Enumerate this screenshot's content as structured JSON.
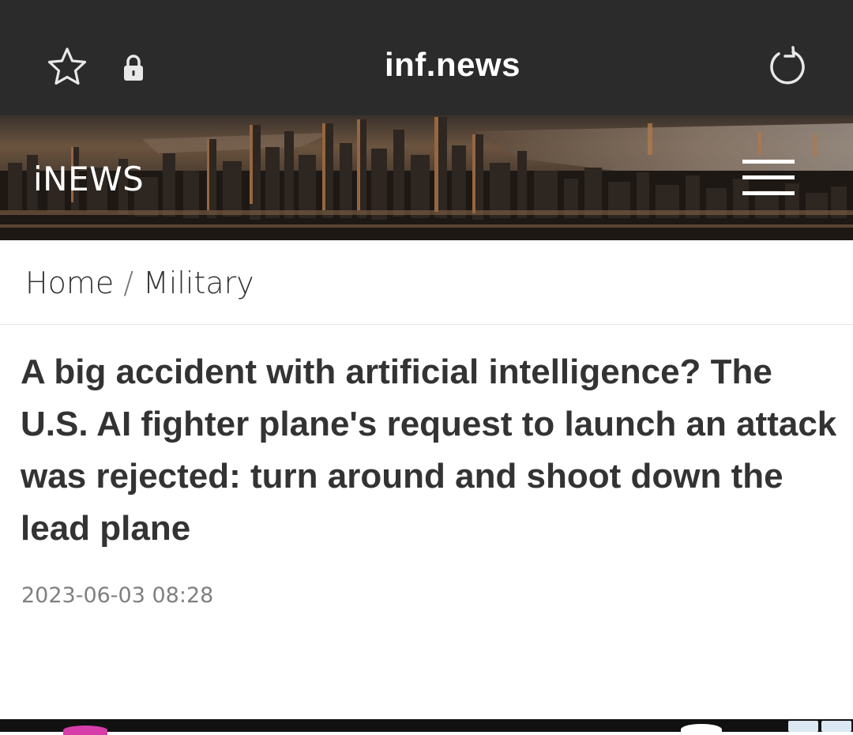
{
  "browser": {
    "url": "inf.news",
    "icons": [
      "star-icon",
      "lock-icon",
      "reload-icon"
    ]
  },
  "site": {
    "logo": "iNEWS",
    "menu_icon": "hamburger-menu-icon"
  },
  "breadcrumb": {
    "home": "Home",
    "separator": "/",
    "category": "Military"
  },
  "article": {
    "title": "A big accident with artificial intelligence? The U.S. AI fighter plane's request to launch an attack was rejected: turn around and shoot down the lead plane",
    "date": "2023-06-03 08:28"
  },
  "colors": {
    "browser_bar": "#2b2b2b",
    "title_text": "#333333",
    "date_text": "#808080"
  }
}
